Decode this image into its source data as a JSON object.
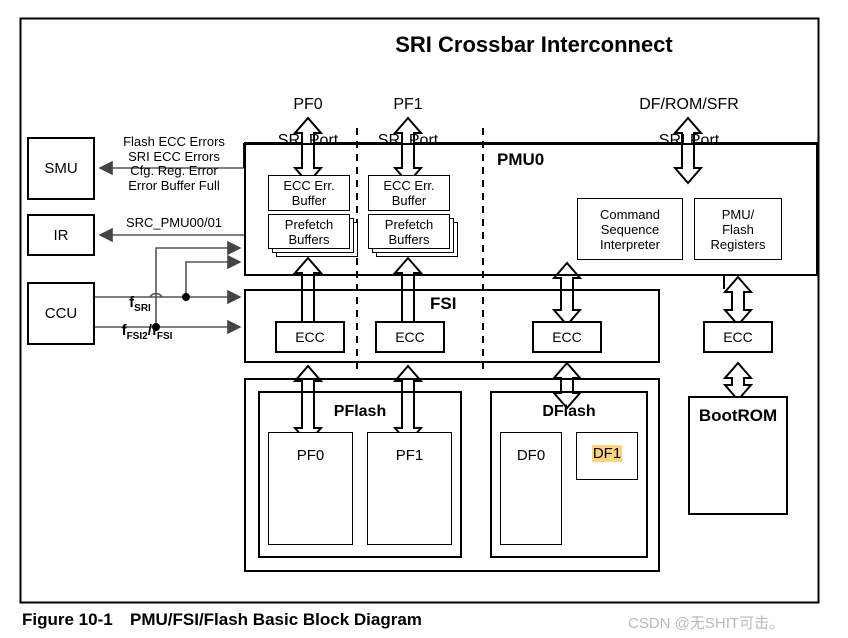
{
  "figure": {
    "caption_number": "Figure 10-1",
    "caption_title": "PMU/FSI/Flash Basic Block Diagram",
    "watermark": "CSDN @无SHIT可击。"
  },
  "header": {
    "title": "SRI Crossbar Interconnect",
    "ports": [
      {
        "line1": "PF0",
        "line2": "SRI Port"
      },
      {
        "line1": "PF1",
        "line2": "SRI Port"
      },
      {
        "line1": "DF/ROM/SFR",
        "line2": "SRI Port"
      }
    ]
  },
  "left_blocks": [
    {
      "label": "SMU"
    },
    {
      "label": "IR"
    },
    {
      "label": "CCU"
    }
  ],
  "signals": {
    "smu_lines": "Flash ECC Errors\nSRI ECC Errors\nCfg. Reg. Error\nError Buffer Full",
    "ir_line": "SRC_PMU00/01",
    "clock_sri": "f",
    "clock_sri_sub": "SRI",
    "clock_fsi_a": "f",
    "clock_fsi_a_sub": "FSI2",
    "clock_fsi_sep": "/",
    "clock_fsi_b": "f",
    "clock_fsi_b_sub": "FSI"
  },
  "pmu0": {
    "title": "PMU0",
    "columns": [
      {
        "ecc_err_buffer": "ECC Err.\nBuffer",
        "prefetch_buffers": "Prefetch\nBuffers"
      },
      {
        "ecc_err_buffer": "ECC Err.\nBuffer",
        "prefetch_buffers": "Prefetch\nBuffers"
      }
    ],
    "command_sequence_interpreter": "Command\nSequence\nInterpreter",
    "pmu_flash_registers": "PMU/\nFlash\nRegisters"
  },
  "fsi": {
    "title": "FSI",
    "ecc_blocks": [
      "ECC",
      "ECC",
      "ECC"
    ]
  },
  "right_column": {
    "ecc": "ECC",
    "bootrom": "BootROM"
  },
  "flash": {
    "pflash": {
      "title": "PFlash",
      "banks": [
        "PF0",
        "PF1"
      ]
    },
    "dflash": {
      "title": "DFlash",
      "banks": [
        "DF0",
        "DF1"
      ],
      "highlighted_bank": "DF1"
    }
  },
  "colors": {
    "stroke": "#000000",
    "highlight": "#ffd480",
    "watermark": "#b9b9b9"
  }
}
